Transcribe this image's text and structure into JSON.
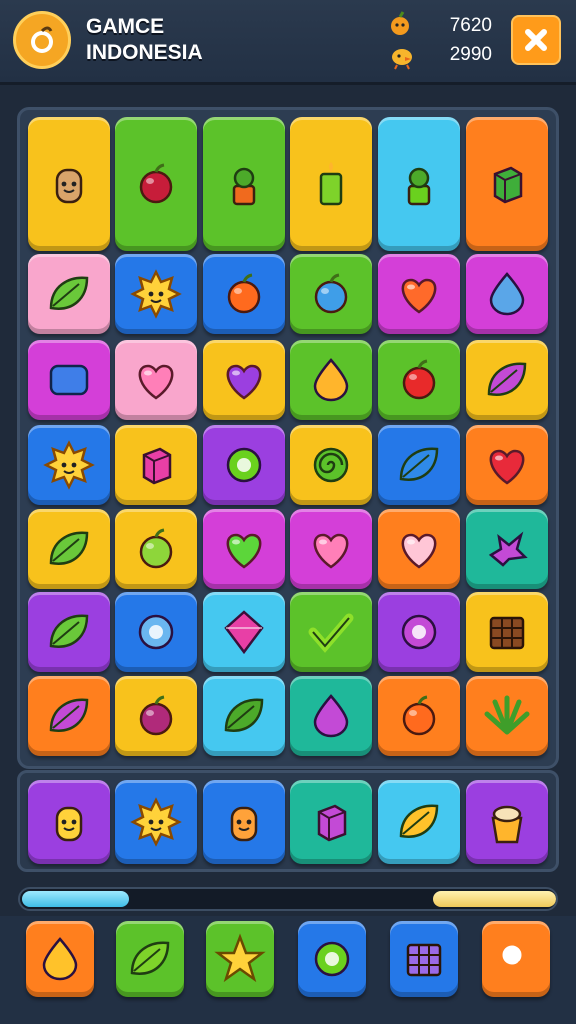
{
  "header": {
    "title_line1": "GAMCE",
    "title_line2": "INDONESIA",
    "stat1_value": "7620",
    "stat2_value": "2990",
    "logo_icon": "orange-logo-icon",
    "stat1_icon": "orange-character-icon",
    "stat2_icon": "chick-character-icon",
    "close_icon": "close-icon"
  },
  "board": {
    "rows": [
      [
        "onion-character",
        "cherries-banana",
        "potted-plant",
        "green-candle",
        "green-jar",
        "leafy-plant"
      ],
      [
        "green-leaf",
        "sun-face",
        "orange-fruit",
        "blue-apple",
        "orange-heart",
        "blue-gem"
      ],
      [
        "blue-square-gem",
        "pink-heart",
        "purple-heart",
        "orange-mango",
        "red-apple",
        "purple-leaf"
      ],
      [
        "sun-face",
        "pink-cube",
        "green-ring",
        "spiral-snail",
        "blue-leaf",
        "red-heart"
      ],
      [
        "green-leaf",
        "lime",
        "green-heart",
        "pink-heart",
        "light-pink-heart",
        "purple-splash"
      ],
      [
        "green-leaf",
        "blue-orb",
        "pink-star",
        "green-check",
        "purple-ring",
        "chocolate-block"
      ],
      [
        "purple-leaf",
        "berry-swirl",
        "striped-leaf",
        "purple-drop",
        "orange-fruit",
        "green-sprout"
      ]
    ]
  },
  "tray": {
    "items": [
      "yellow-bird",
      "sun-face",
      "orange-cat",
      "purple-box",
      "mango-leaf",
      "ice-cream-cup"
    ]
  },
  "progress": {
    "fill_fraction": 0.2,
    "end_marker_fraction": 0.23
  },
  "tools": {
    "items": [
      "lemon-tool",
      "leaf-tool",
      "star-tool",
      "magnify-orb-tool",
      "cube-tool",
      "search-tool"
    ]
  },
  "colors": {
    "yellow": "#f8c21c",
    "green": "#5cc22a",
    "orange": "#ff7f1e",
    "blue": "#2578e8",
    "pink": "#f06bc8",
    "lightpink": "#f9a6cc",
    "magenta": "#d43fd8",
    "purple": "#9b3fe0",
    "cyan": "#45c8f0",
    "teal": "#1fb89a",
    "lime": "#9fe02a"
  }
}
